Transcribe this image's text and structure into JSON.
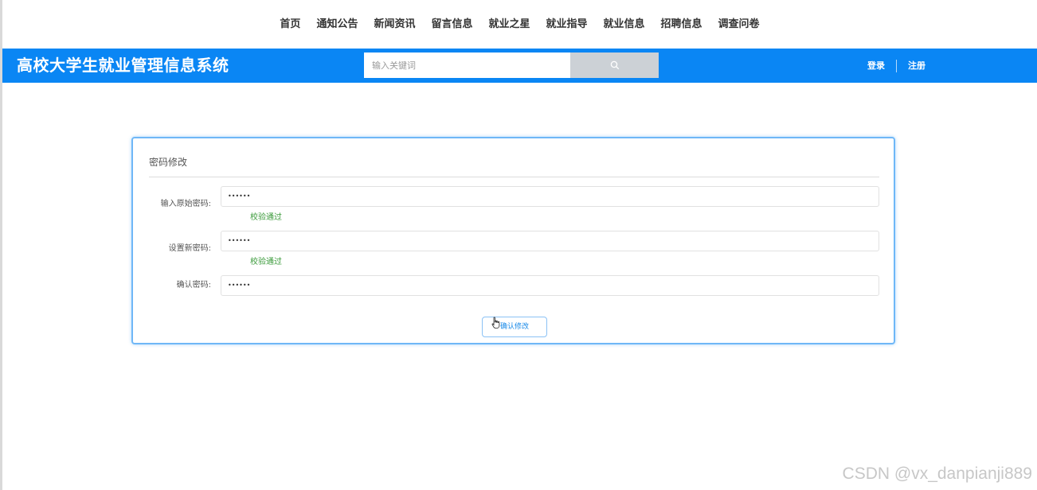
{
  "topnav": {
    "items": [
      "首页",
      "通知公告",
      "新闻资讯",
      "留言信息",
      "就业之星",
      "就业指导",
      "就业信息",
      "招聘信息",
      "调查问卷"
    ]
  },
  "header": {
    "title": "高校大学生就业管理信息系统",
    "search_placeholder": "输入关键词",
    "login": "登录",
    "register": "注册",
    "color": "#0a86f4"
  },
  "form": {
    "title": "密码修改",
    "fields": [
      {
        "label": "输入原始密码:",
        "value": "••••••",
        "status": "校验通过"
      },
      {
        "label": "设置新密码:",
        "value": "••••••",
        "status": "校验通过"
      },
      {
        "label": "确认密码:",
        "value": "••••••",
        "status": ""
      }
    ],
    "submit_label": "确认修改",
    "status_color": "#3a9a3a"
  },
  "watermark": "CSDN @vx_danpianji889"
}
